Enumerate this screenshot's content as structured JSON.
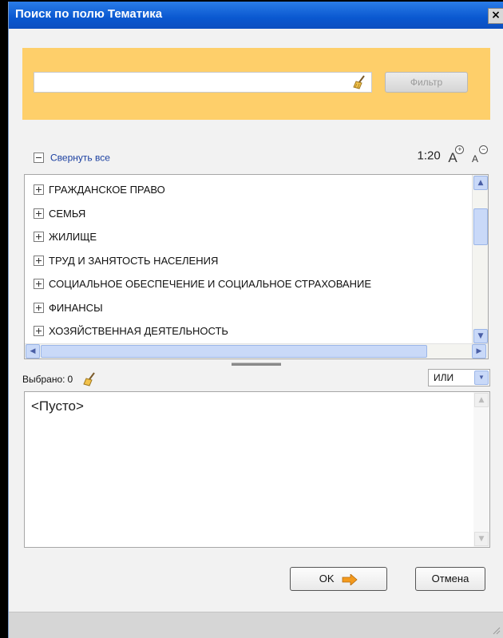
{
  "window": {
    "title": "Поиск по полю Тематика",
    "close_label": "×"
  },
  "filter": {
    "input_value": "",
    "placeholder": "",
    "button_label": "Фильтр"
  },
  "toolbar": {
    "collapse_all": "Свернуть все",
    "zoom_level": "1:20",
    "zoom_in_glyph": "A",
    "zoom_out_glyph": "A"
  },
  "tree": {
    "items": [
      {
        "label": "ГРАЖДАНСКОЕ ПРАВО"
      },
      {
        "label": "СЕМЬЯ"
      },
      {
        "label": "ЖИЛИЩЕ"
      },
      {
        "label": "ТРУД И ЗАНЯТОСТЬ НАСЕЛЕНИЯ"
      },
      {
        "label": "СОЦИАЛЬНОЕ ОБЕСПЕЧЕНИЕ И СОЦИАЛЬНОЕ СТРАХОВАНИЕ"
      },
      {
        "label": "ФИНАНСЫ"
      },
      {
        "label": "ХОЗЯЙСТВЕННАЯ ДЕЯТЕЛЬНОСТЬ"
      }
    ]
  },
  "selection": {
    "label": "Выбрано:",
    "count": "0",
    "logic_value": "ИЛИ",
    "empty_text": "<Пусто>"
  },
  "buttons": {
    "ok": "OK",
    "cancel": "Отмена"
  },
  "icons": {
    "broom": "broom-icon",
    "arrow": "arrow-right-icon"
  },
  "colors": {
    "titlebar": "#0a58d0",
    "filter_panel": "#fecf6a",
    "link": "#1a3fa0"
  }
}
